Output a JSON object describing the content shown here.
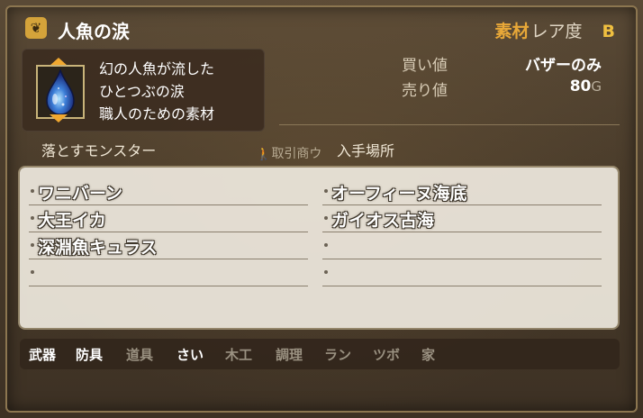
{
  "item": {
    "name": "人魚の涙",
    "icon": "teardrop-gem-icon",
    "description": [
      "幻の人魚が流した",
      "ひとつぶの涙",
      "職人のための素材"
    ]
  },
  "rarity": {
    "kind": "素材",
    "label": "レア度",
    "value": "B"
  },
  "prices": {
    "buy_label": "買い値",
    "buy_value": "バザーのみ",
    "sell_label": "売り値",
    "sell_value": "80",
    "currency": "G"
  },
  "headers": {
    "monster": "落とすモンスター",
    "trade": "取引商ウ",
    "place": "入手場所"
  },
  "monsters": [
    "ワニバーン",
    "大王イカ",
    "深淵魚キュラス",
    ""
  ],
  "places": [
    "オーフィーヌ海底",
    "ガイオス古海",
    "",
    ""
  ],
  "categories": [
    {
      "label": "武器",
      "active": true
    },
    {
      "label": "防具",
      "active": true
    },
    {
      "label": "道具",
      "active": false
    },
    {
      "label": "さい",
      "active": true
    },
    {
      "label": "木工",
      "active": false
    },
    {
      "label": "調理",
      "active": false
    },
    {
      "label": "ラン",
      "active": false
    },
    {
      "label": "ツボ",
      "active": false
    },
    {
      "label": "家",
      "active": false
    }
  ],
  "colors": {
    "accent": "#e8a838",
    "rarity_value": "#f0c040",
    "panel": "#eee8de"
  }
}
